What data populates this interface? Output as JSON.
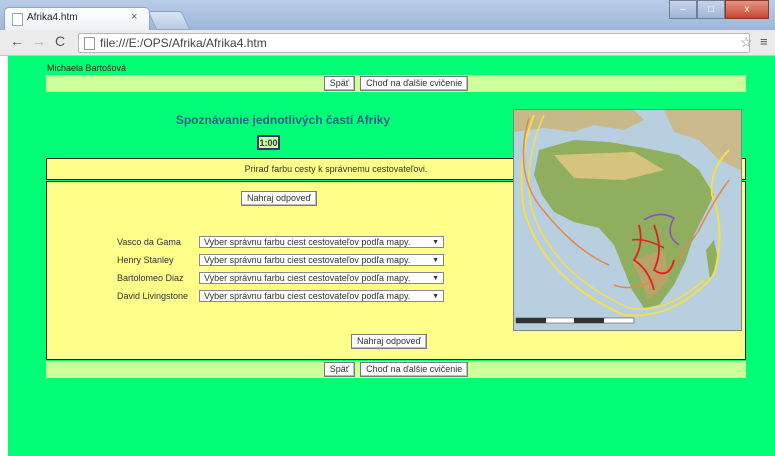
{
  "browser": {
    "tab_title": "Afrika4.htm",
    "tab_close": "×",
    "url": "file:///E:/OPS/Afrika/Afrika4.htm",
    "window_minimize": "–",
    "window_maximize": "□",
    "window_close": "x"
  },
  "page": {
    "author": "Michaela Bartošová",
    "nav": {
      "back_label": "Späť",
      "next_label": "Choď na ďalšie cvičenie"
    },
    "title": "Spoznávanie jednotlivých častí Afriky",
    "timer": "1:00",
    "instruction": "Priraď farbu cesty k správnemu cestovateľovi.",
    "upload_label": "Nahraj odpoveď",
    "explorers": [
      {
        "name": "Vasco da Gama",
        "selected": "Vyber správnu farbu ciest cestovateľov podľa mapy."
      },
      {
        "name": "Henry Stanley",
        "selected": "Vyber správnu farbu ciest cestovateľov podľa mapy."
      },
      {
        "name": "Bartolomeo Diaz",
        "selected": "Vyber správnu farbu ciest cestovateľov podľa mapy."
      },
      {
        "name": "David Livingstone",
        "selected": "Vyber správnu farbu ciest cestovateľov podľa mapy."
      }
    ]
  },
  "colors": {
    "page_bg": "#00ff77",
    "bar_bg": "#ccff99",
    "panel_bg": "#ffff8a",
    "title": "#2c5f8a"
  }
}
